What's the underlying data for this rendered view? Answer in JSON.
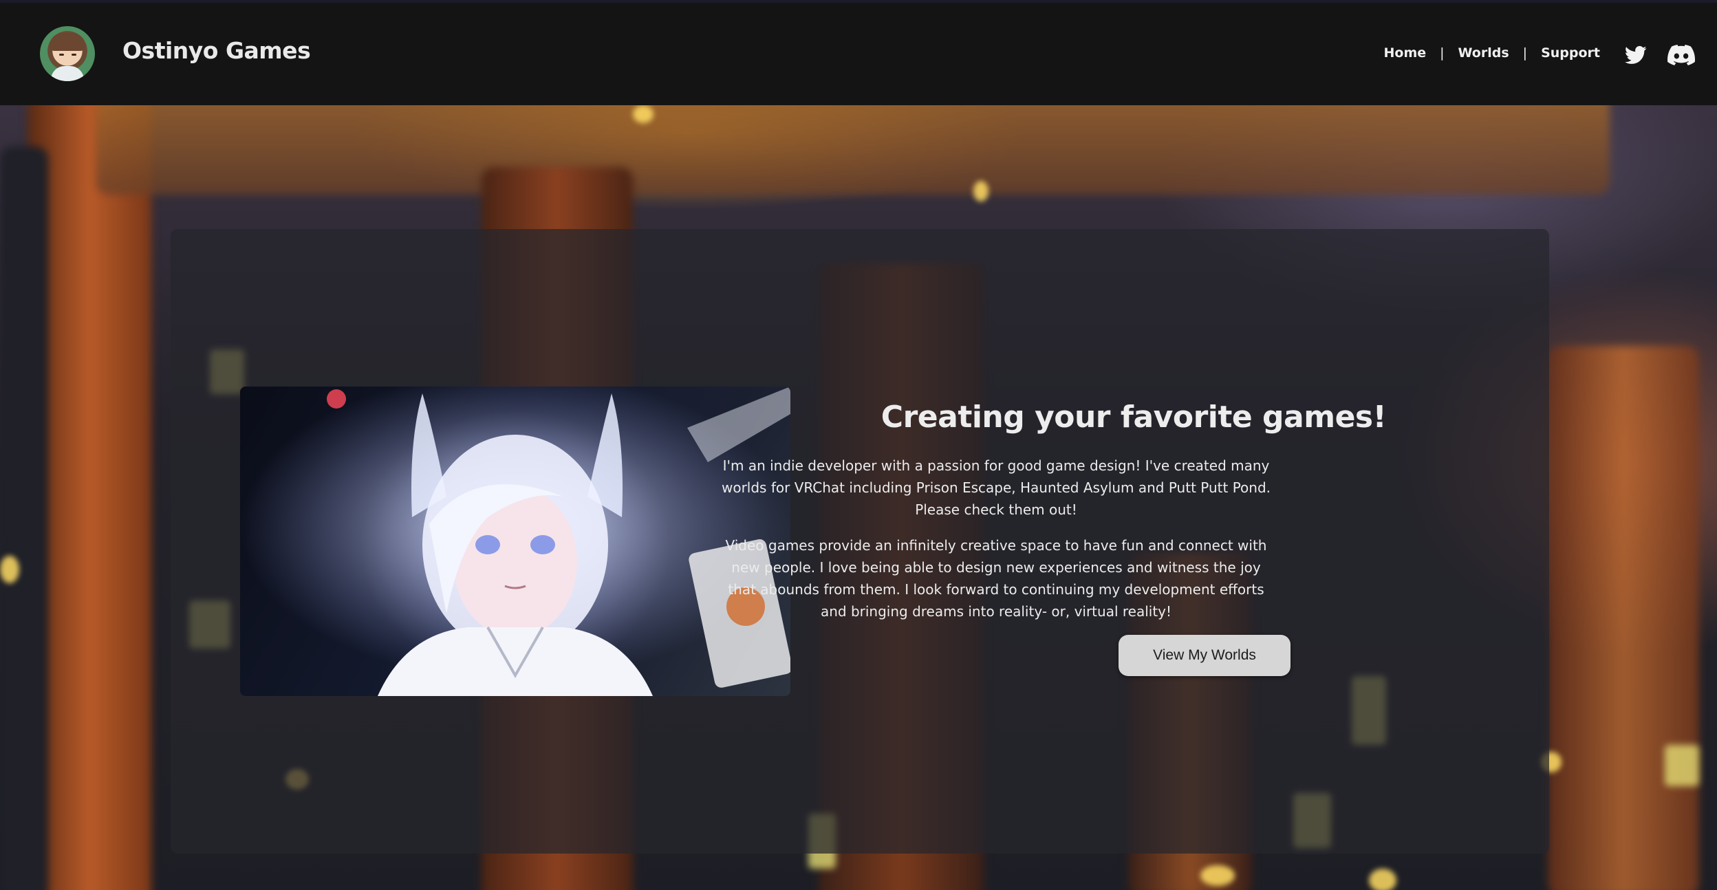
{
  "header": {
    "site_title": "Ostinyo Games",
    "avatar_icon": "developer-avatar",
    "nav": [
      {
        "label": "Home"
      },
      {
        "label": "Worlds"
      },
      {
        "label": "Support"
      }
    ],
    "nav_separator": "|",
    "social_icons": [
      "twitter-icon",
      "discord-icon"
    ]
  },
  "hero": {
    "headline": "Creating your favorite games!",
    "paragraph_1": "I'm an indie developer with a passion for good game design! I've created many worlds for VRChat including Prison Escape, Haunted Asylum and Putt Putt Pond. Please check them out!",
    "paragraph_2": "Video games provide an infinitely creative space to have fun and connect with new people. I love being able to design new experiences and witness the joy that abounds from them. I look forward to continuing my development efforts and bringing dreams into reality- or, virtual reality!",
    "cta_label": "View My Worlds",
    "image_subject": "anime-avatar-screenshot"
  },
  "colors": {
    "header_bg": "#141414",
    "card_bg": "rgba(38,38,44,0.72)",
    "text": "#ececec",
    "button_bg": "#d6d6d6"
  }
}
